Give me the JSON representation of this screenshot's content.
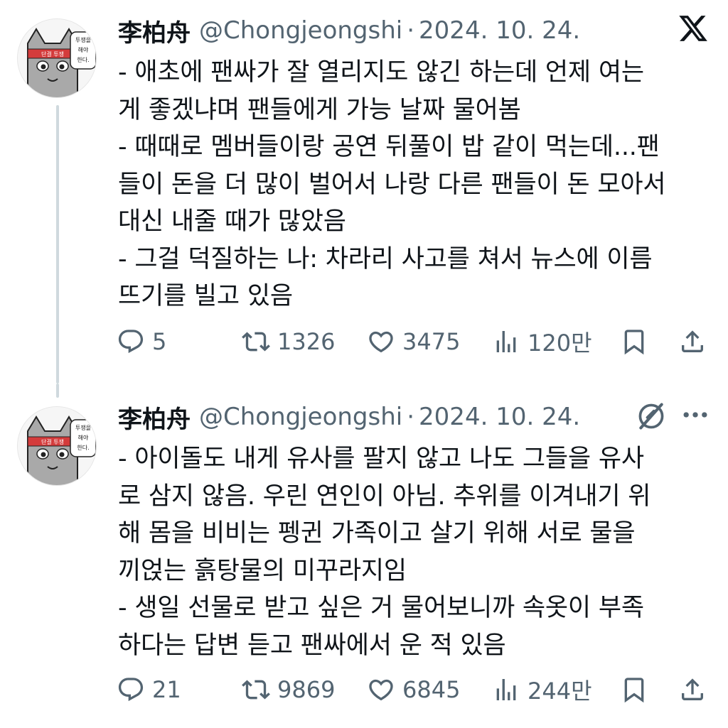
{
  "tweets": [
    {
      "author_name": "李柏舟",
      "handle": "@Chongjeongshi",
      "separator": "·",
      "date": "2024. 10. 24.",
      "avatar_text": {
        "sign_top": "투쟁을",
        "sign_mid": "해야",
        "sign_bot": "한다.",
        "band": "단결 투쟁"
      },
      "lines": [
        "- 애초에 팬싸가 잘 열리지도 않긴 하는데 언제 여는",
        "게 좋겠냐며 팬들에게 가능 날짜 물어봄",
        "- 때때로 멤버들이랑 공연 뒤풀이 밥 같이 먹는데...팬",
        "들이 돈을 더 많이 벌어서 나랑 다른 팬들이 돈 모아서",
        "대신 내줄 때가 많았음",
        "- 그걸 덕질하는 나: 차라리 사고를 쳐서 뉴스에 이름",
        "뜨기를 빌고 있음"
      ],
      "stats": {
        "replies": "5",
        "retweets": "1326",
        "likes": "3475",
        "views": "120만"
      },
      "icons": [
        "x-logo",
        "reply-icon",
        "retweet-icon",
        "like-icon",
        "views-icon",
        "bookmark-icon",
        "share-icon"
      ]
    },
    {
      "author_name": "李柏舟",
      "handle": "@Chongjeongshi",
      "separator": "·",
      "date": "2024. 10. 24.",
      "avatar_text": {
        "sign_top": "투쟁을",
        "sign_mid": "해야",
        "sign_bot": "한다.",
        "band": "단결 투쟁"
      },
      "lines": [
        "- 아이돌도 내게 유사를 팔지 않고 나도 그들을 유사",
        "로 삼지 않음. 우린 연인이 아님. 추위를 이겨내기 위",
        "해 몸을 비비는 펭귄 가족이고 살기 위해 서로 물을",
        "끼얹는 흙탕물의 미꾸라지임",
        "- 생일 선물로 받고 싶은 거 물어보니까 속옷이 부족",
        "하다는 답변 듣고 팬싸에서 운 적 있음"
      ],
      "stats": {
        "replies": "21",
        "retweets": "9869",
        "likes": "6845",
        "views": "244만"
      },
      "icons": [
        "grok-icon",
        "more-icon",
        "reply-icon",
        "retweet-icon",
        "like-icon",
        "views-icon",
        "bookmark-icon",
        "share-icon"
      ]
    }
  ],
  "colors": {
    "text": "#0f1419",
    "secondary": "#536471",
    "thread_line": "#cfd9de",
    "avatar_band": "#d43b3b"
  }
}
